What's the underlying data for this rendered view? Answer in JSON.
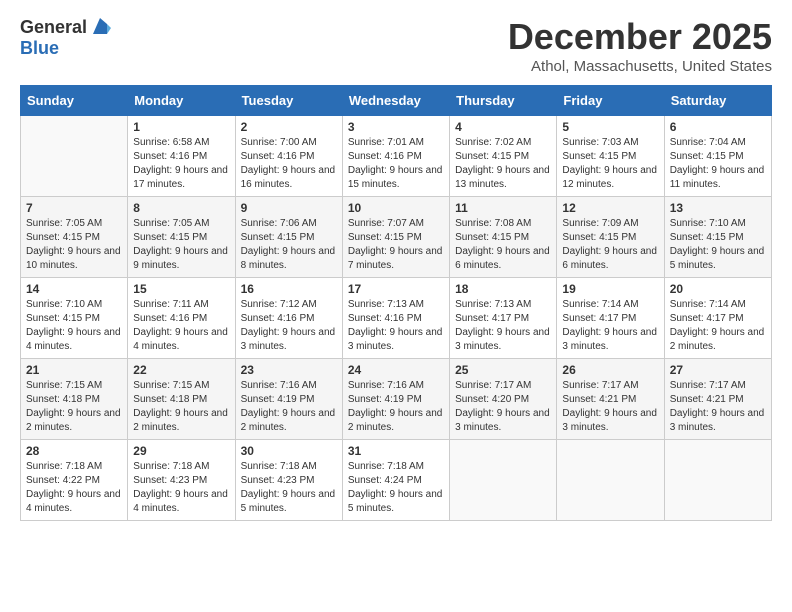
{
  "header": {
    "logo_general": "General",
    "logo_blue": "Blue",
    "month_title": "December 2025",
    "location": "Athol, Massachusetts, United States"
  },
  "days_of_week": [
    "Sunday",
    "Monday",
    "Tuesday",
    "Wednesday",
    "Thursday",
    "Friday",
    "Saturday"
  ],
  "weeks": [
    [
      {
        "day": "",
        "sunrise": "",
        "sunset": "",
        "daylight": ""
      },
      {
        "day": "1",
        "sunrise": "Sunrise: 6:58 AM",
        "sunset": "Sunset: 4:16 PM",
        "daylight": "Daylight: 9 hours and 17 minutes."
      },
      {
        "day": "2",
        "sunrise": "Sunrise: 7:00 AM",
        "sunset": "Sunset: 4:16 PM",
        "daylight": "Daylight: 9 hours and 16 minutes."
      },
      {
        "day": "3",
        "sunrise": "Sunrise: 7:01 AM",
        "sunset": "Sunset: 4:16 PM",
        "daylight": "Daylight: 9 hours and 15 minutes."
      },
      {
        "day": "4",
        "sunrise": "Sunrise: 7:02 AM",
        "sunset": "Sunset: 4:15 PM",
        "daylight": "Daylight: 9 hours and 13 minutes."
      },
      {
        "day": "5",
        "sunrise": "Sunrise: 7:03 AM",
        "sunset": "Sunset: 4:15 PM",
        "daylight": "Daylight: 9 hours and 12 minutes."
      },
      {
        "day": "6",
        "sunrise": "Sunrise: 7:04 AM",
        "sunset": "Sunset: 4:15 PM",
        "daylight": "Daylight: 9 hours and 11 minutes."
      }
    ],
    [
      {
        "day": "7",
        "sunrise": "Sunrise: 7:05 AM",
        "sunset": "Sunset: 4:15 PM",
        "daylight": "Daylight: 9 hours and 10 minutes."
      },
      {
        "day": "8",
        "sunrise": "Sunrise: 7:05 AM",
        "sunset": "Sunset: 4:15 PM",
        "daylight": "Daylight: 9 hours and 9 minutes."
      },
      {
        "day": "9",
        "sunrise": "Sunrise: 7:06 AM",
        "sunset": "Sunset: 4:15 PM",
        "daylight": "Daylight: 9 hours and 8 minutes."
      },
      {
        "day": "10",
        "sunrise": "Sunrise: 7:07 AM",
        "sunset": "Sunset: 4:15 PM",
        "daylight": "Daylight: 9 hours and 7 minutes."
      },
      {
        "day": "11",
        "sunrise": "Sunrise: 7:08 AM",
        "sunset": "Sunset: 4:15 PM",
        "daylight": "Daylight: 9 hours and 6 minutes."
      },
      {
        "day": "12",
        "sunrise": "Sunrise: 7:09 AM",
        "sunset": "Sunset: 4:15 PM",
        "daylight": "Daylight: 9 hours and 6 minutes."
      },
      {
        "day": "13",
        "sunrise": "Sunrise: 7:10 AM",
        "sunset": "Sunset: 4:15 PM",
        "daylight": "Daylight: 9 hours and 5 minutes."
      }
    ],
    [
      {
        "day": "14",
        "sunrise": "Sunrise: 7:10 AM",
        "sunset": "Sunset: 4:15 PM",
        "daylight": "Daylight: 9 hours and 4 minutes."
      },
      {
        "day": "15",
        "sunrise": "Sunrise: 7:11 AM",
        "sunset": "Sunset: 4:16 PM",
        "daylight": "Daylight: 9 hours and 4 minutes."
      },
      {
        "day": "16",
        "sunrise": "Sunrise: 7:12 AM",
        "sunset": "Sunset: 4:16 PM",
        "daylight": "Daylight: 9 hours and 3 minutes."
      },
      {
        "day": "17",
        "sunrise": "Sunrise: 7:13 AM",
        "sunset": "Sunset: 4:16 PM",
        "daylight": "Daylight: 9 hours and 3 minutes."
      },
      {
        "day": "18",
        "sunrise": "Sunrise: 7:13 AM",
        "sunset": "Sunset: 4:17 PM",
        "daylight": "Daylight: 9 hours and 3 minutes."
      },
      {
        "day": "19",
        "sunrise": "Sunrise: 7:14 AM",
        "sunset": "Sunset: 4:17 PM",
        "daylight": "Daylight: 9 hours and 3 minutes."
      },
      {
        "day": "20",
        "sunrise": "Sunrise: 7:14 AM",
        "sunset": "Sunset: 4:17 PM",
        "daylight": "Daylight: 9 hours and 2 minutes."
      }
    ],
    [
      {
        "day": "21",
        "sunrise": "Sunrise: 7:15 AM",
        "sunset": "Sunset: 4:18 PM",
        "daylight": "Daylight: 9 hours and 2 minutes."
      },
      {
        "day": "22",
        "sunrise": "Sunrise: 7:15 AM",
        "sunset": "Sunset: 4:18 PM",
        "daylight": "Daylight: 9 hours and 2 minutes."
      },
      {
        "day": "23",
        "sunrise": "Sunrise: 7:16 AM",
        "sunset": "Sunset: 4:19 PM",
        "daylight": "Daylight: 9 hours and 2 minutes."
      },
      {
        "day": "24",
        "sunrise": "Sunrise: 7:16 AM",
        "sunset": "Sunset: 4:19 PM",
        "daylight": "Daylight: 9 hours and 2 minutes."
      },
      {
        "day": "25",
        "sunrise": "Sunrise: 7:17 AM",
        "sunset": "Sunset: 4:20 PM",
        "daylight": "Daylight: 9 hours and 3 minutes."
      },
      {
        "day": "26",
        "sunrise": "Sunrise: 7:17 AM",
        "sunset": "Sunset: 4:21 PM",
        "daylight": "Daylight: 9 hours and 3 minutes."
      },
      {
        "day": "27",
        "sunrise": "Sunrise: 7:17 AM",
        "sunset": "Sunset: 4:21 PM",
        "daylight": "Daylight: 9 hours and 3 minutes."
      }
    ],
    [
      {
        "day": "28",
        "sunrise": "Sunrise: 7:18 AM",
        "sunset": "Sunset: 4:22 PM",
        "daylight": "Daylight: 9 hours and 4 minutes."
      },
      {
        "day": "29",
        "sunrise": "Sunrise: 7:18 AM",
        "sunset": "Sunset: 4:23 PM",
        "daylight": "Daylight: 9 hours and 4 minutes."
      },
      {
        "day": "30",
        "sunrise": "Sunrise: 7:18 AM",
        "sunset": "Sunset: 4:23 PM",
        "daylight": "Daylight: 9 hours and 5 minutes."
      },
      {
        "day": "31",
        "sunrise": "Sunrise: 7:18 AM",
        "sunset": "Sunset: 4:24 PM",
        "daylight": "Daylight: 9 hours and 5 minutes."
      },
      {
        "day": "",
        "sunrise": "",
        "sunset": "",
        "daylight": ""
      },
      {
        "day": "",
        "sunrise": "",
        "sunset": "",
        "daylight": ""
      },
      {
        "day": "",
        "sunrise": "",
        "sunset": "",
        "daylight": ""
      }
    ]
  ]
}
